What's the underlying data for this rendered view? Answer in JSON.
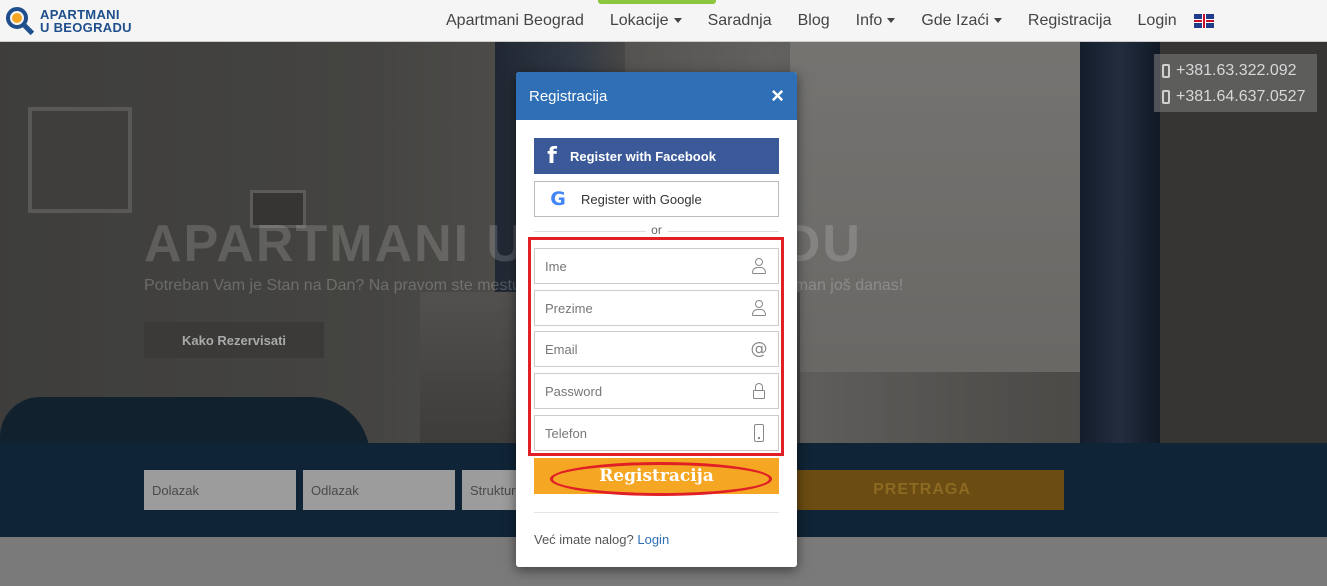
{
  "nav": {
    "logo_line1": "APARTMANI",
    "logo_line2": "U BEOGRADU",
    "items": [
      {
        "label": "Apartmani Beograd",
        "dropdown": false
      },
      {
        "label": "Lokacije",
        "dropdown": true
      },
      {
        "label": "Saradnja",
        "dropdown": false
      },
      {
        "label": "Blog",
        "dropdown": false
      },
      {
        "label": "Info",
        "dropdown": true
      },
      {
        "label": "Gde Izaći",
        "dropdown": true
      },
      {
        "label": "Registracija",
        "dropdown": false
      },
      {
        "label": "Login",
        "dropdown": false
      }
    ],
    "language_icon": "uk-flag-icon"
  },
  "hero": {
    "title": "APARTMANI U BEOGRADU",
    "subtitle": "Potreban Vam je Stan na Dan? Na pravom ste mestu. Pregledajte ponudu i rezervišite apartman još danas!",
    "button_label": "Kako Rezervisati",
    "phones": [
      "+381.63.322.092",
      "+381.64.637.0527"
    ]
  },
  "search": {
    "arrival_placeholder": "Dolazak",
    "departure_placeholder": "Odlazak",
    "structure_placeholder": "Struktura",
    "button_label": "PRETRAGA"
  },
  "modal": {
    "title": "Registracija",
    "close_symbol": "×",
    "facebook_label": "Register with Facebook",
    "google_label": "Register with Google",
    "or_text": "or",
    "fields": {
      "first_name": {
        "placeholder": "Ime",
        "value": ""
      },
      "last_name": {
        "placeholder": "Prezime",
        "value": ""
      },
      "email": {
        "placeholder": "Email",
        "value": ""
      },
      "password": {
        "placeholder": "Password",
        "value": ""
      },
      "phone": {
        "placeholder": "Telefon",
        "value": ""
      }
    },
    "submit_label": "Registracija",
    "footer_prefix": "Već imate nalog?",
    "footer_link": "Login"
  },
  "colors": {
    "modal_header": "#2f6fb5",
    "facebook": "#3b5998",
    "submit": "#f5a623",
    "annotation_red": "#e01f26",
    "nav_accent": "#8cc63f"
  }
}
